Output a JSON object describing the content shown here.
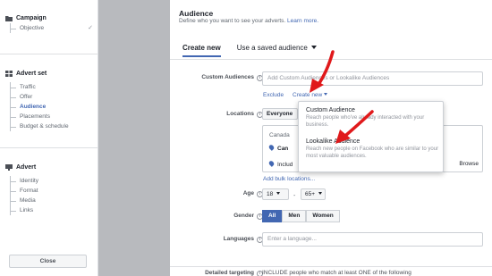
{
  "sidebar": {
    "campaign": {
      "label": "Campaign",
      "items": [
        {
          "label": "Objective",
          "done": true
        }
      ]
    },
    "adset": {
      "label": "Advert set",
      "items": [
        {
          "label": "Traffic"
        },
        {
          "label": "Offer"
        },
        {
          "label": "Audience",
          "active": true
        },
        {
          "label": "Placements"
        },
        {
          "label": "Budget & schedule"
        }
      ]
    },
    "advert": {
      "label": "Advert",
      "items": [
        {
          "label": "Identity"
        },
        {
          "label": "Format"
        },
        {
          "label": "Media"
        },
        {
          "label": "Links"
        }
      ]
    },
    "close_label": "Close",
    "check_icon": "✓"
  },
  "main": {
    "title": "Audience",
    "subtitle": "Define who you want to see your adverts.",
    "learn_more": "Learn more.",
    "tabs": {
      "create_new": "Create new",
      "saved": "Use a saved audience"
    },
    "custom_audiences": {
      "label": "Custom Audiences",
      "placeholder": "Add Custom Audiences or Lookalike Audiences",
      "exclude": "Exclude",
      "create_new": "Create new"
    },
    "locations": {
      "label": "Locations",
      "select_value": "Everyone",
      "country": "Canada",
      "city": "Can",
      "include": "Includ",
      "browse": "Browse",
      "bulk": "Add bulk locations..."
    },
    "age": {
      "label": "Age",
      "min": "18",
      "max": "65+"
    },
    "gender": {
      "label": "Gender",
      "options": [
        "All",
        "Men",
        "Women"
      ],
      "selected": "All"
    },
    "languages": {
      "label": "Languages",
      "placeholder": "Enter a language..."
    },
    "detailed": {
      "label": "Detailed targeting",
      "text": "INCLUDE people who match at least ONE of the following"
    }
  },
  "popup": {
    "items": [
      {
        "title": "Custom Audience",
        "desc": "Reach people who've already interacted with your business."
      },
      {
        "title": "Lookalike Audience",
        "desc": "Reach new people on Facebook who are similar to your most valuable audiences."
      }
    ]
  },
  "colors": {
    "accent": "#4267b2",
    "arrow": "#e0191b"
  }
}
